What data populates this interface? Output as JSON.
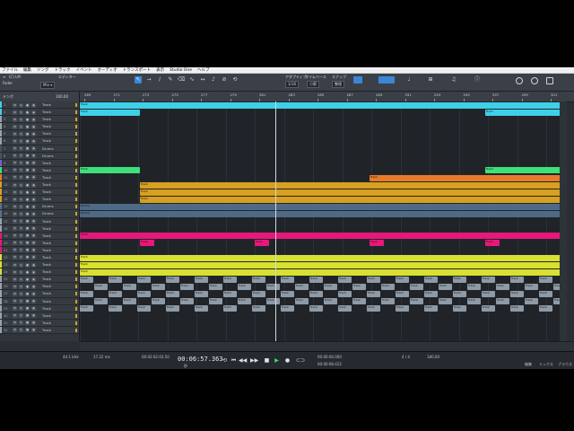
{
  "menu": [
    "ファイル",
    "編集",
    "ソング",
    "トラック",
    "イベント",
    "オーディオ",
    "トランスポート",
    "表示",
    "Studio One",
    "ヘルプ"
  ],
  "toolbar": {
    "project_label": "(C) LM",
    "mode_label": "Fader",
    "edit_label": "エディター",
    "snap_label": "アダプティブ",
    "snap_value": "1/16",
    "timebase_label": "タイムベース",
    "timebase_value": "小節",
    "snap2_label": "スナップ",
    "snap2_value": "整理",
    "tools": [
      "↖",
      "→",
      "∕",
      "✎",
      "⌫",
      "∿",
      "↔",
      "♪",
      "⊘",
      "⟲"
    ]
  },
  "trackpanel": {
    "header_left": "テンポ",
    "header_right": "100.00",
    "rows": [
      {
        "num": "1",
        "name": "Track",
        "color": "#3fd0e8"
      },
      {
        "num": "2",
        "name": "Track",
        "color": "#3fd0e8"
      },
      {
        "num": "3",
        "name": "Track",
        "color": "#9aa3ad"
      },
      {
        "num": "4",
        "name": "Track",
        "color": "#9aa3ad"
      },
      {
        "num": "5",
        "name": "Track",
        "color": "#9aa3ad"
      },
      {
        "num": "6",
        "name": "Track",
        "color": "#9aa3ad"
      },
      {
        "num": "7",
        "name": "Drums",
        "color": "#4a5260"
      },
      {
        "num": "8",
        "name": "Drums",
        "color": "#4a5260"
      },
      {
        "num": "9",
        "name": "Track",
        "color": "#7a5cd6"
      },
      {
        "num": "10",
        "name": "Track",
        "color": "#3ee07a"
      },
      {
        "num": "11",
        "name": "Track",
        "color": "#e87a2a"
      },
      {
        "num": "12",
        "name": "Track",
        "color": "#d8a020"
      },
      {
        "num": "13",
        "name": "Track",
        "color": "#d8a020"
      },
      {
        "num": "14",
        "name": "Track",
        "color": "#d8a020"
      },
      {
        "num": "15",
        "name": "Drums",
        "color": "#5a7090"
      },
      {
        "num": "16",
        "name": "Drums",
        "color": "#5a7090"
      },
      {
        "num": "17",
        "name": "Track",
        "color": "#9aa3ad"
      },
      {
        "num": "18",
        "name": "Track",
        "color": "#9aa3ad"
      },
      {
        "num": "19",
        "name": "Track",
        "color": "#e8187a"
      },
      {
        "num": "20",
        "name": "Track",
        "color": "#e8187a"
      },
      {
        "num": "21",
        "name": "Track",
        "color": "#e8187a"
      },
      {
        "num": "22",
        "name": "Track",
        "color": "#d8e030"
      },
      {
        "num": "23",
        "name": "Track",
        "color": "#d8e030"
      },
      {
        "num": "24",
        "name": "Track",
        "color": "#d8e030"
      },
      {
        "num": "25",
        "name": "Track",
        "color": "#9aa3ad"
      },
      {
        "num": "26",
        "name": "Track",
        "color": "#9aa3ad"
      },
      {
        "num": "27",
        "name": "Track",
        "color": "#9aa3ad"
      },
      {
        "num": "28",
        "name": "Track",
        "color": "#9aa3ad"
      },
      {
        "num": "29",
        "name": "Track",
        "color": "#9aa3ad"
      },
      {
        "num": "30",
        "name": "Track",
        "color": "#9aa3ad"
      },
      {
        "num": "31",
        "name": "Track",
        "color": "#9aa3ad"
      },
      {
        "num": "32",
        "name": "Track",
        "color": "#9aa3ad"
      }
    ]
  },
  "ruler": [
    "269",
    "271",
    "273",
    "275",
    "277",
    "279",
    "281",
    "283",
    "285",
    "287",
    "289",
    "291",
    "293",
    "295",
    "297",
    "299",
    "301"
  ],
  "clip_label": "Track",
  "drum_label": "Drums",
  "transport": {
    "sample_rate": "44.1 kHz",
    "latency": "17.22 ms",
    "time_small": "00:02:02:03.50",
    "time_main": "00:06:57.363",
    "time_label": "秒",
    "left_loc": "00:00:00.000",
    "right_loc": "00:00:08.422",
    "signature": "4 / 4",
    "tempo": "180.00",
    "right_tabs": [
      "編集",
      "ミックス",
      "ブラウズ"
    ]
  },
  "colors": {
    "cyan": "#3fd0e8",
    "green": "#3ee07a",
    "orange": "#e87a2a",
    "gold": "#d8a020",
    "slate": "#4e6a86",
    "magenta": "#e8187a",
    "lime": "#d8e030",
    "grey": "#8e9aa6"
  }
}
